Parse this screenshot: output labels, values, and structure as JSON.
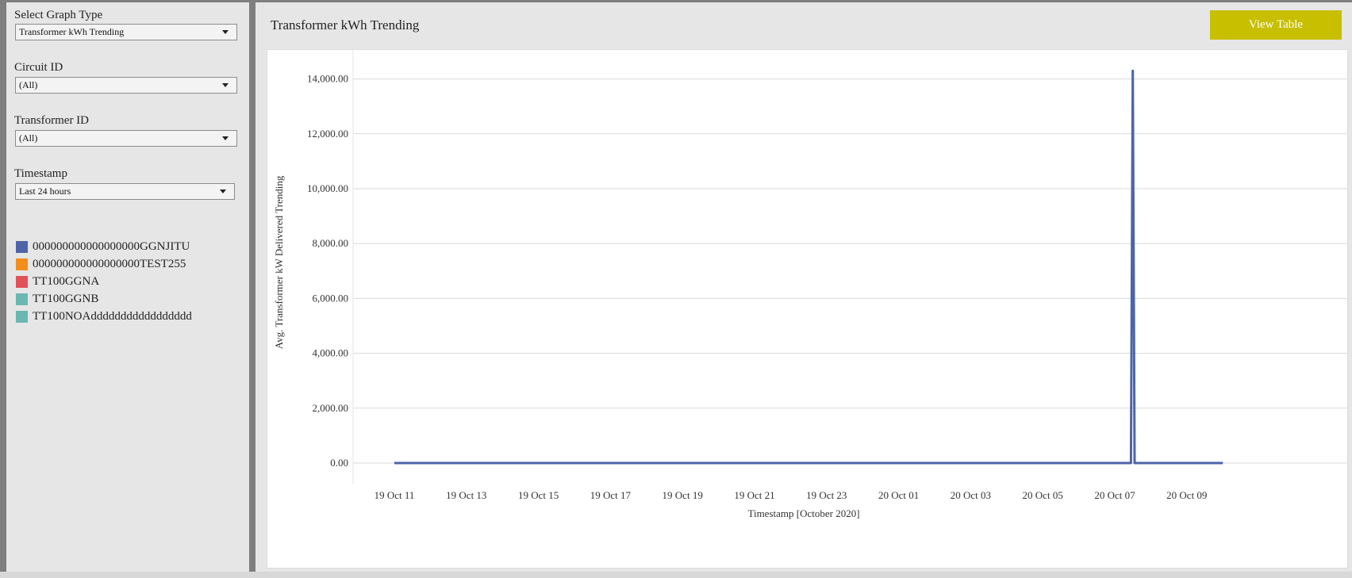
{
  "filters": {
    "graph_type": {
      "label": "Select Graph Type",
      "value": "Transformer kWh Trending"
    },
    "circuit_id": {
      "label": "Circuit ID",
      "value": "(All)"
    },
    "transformer_id": {
      "label": "Transformer ID",
      "value": "(All)"
    },
    "timestamp": {
      "label": "Timestamp",
      "value": "Last 24 hours"
    }
  },
  "legend": [
    {
      "label": "000000000000000000GGNJITU",
      "color": "#4e64a8"
    },
    {
      "label": "000000000000000000TEST255",
      "color": "#f28e1c"
    },
    {
      "label": "TT100GGNA",
      "color": "#e15259"
    },
    {
      "label": "TT100GGNB",
      "color": "#6ab8b0"
    },
    {
      "label": "TT100NOAddddddddddddddddd",
      "color": "#6ab8b0"
    }
  ],
  "header": {
    "title": "Transformer kWh Trending",
    "view_table_label": "View Table"
  },
  "chart_data": {
    "type": "line",
    "xlabel": "Timestamp [October 2020]",
    "ylabel": "Avg. Transformer kW Delivered Trending",
    "ylim": [
      0,
      15000
    ],
    "yticks": [
      "0.00",
      "2,000.00",
      "4,000.00",
      "6,000.00",
      "8,000.00",
      "10,000.00",
      "12,000.00",
      "14,000.00"
    ],
    "ytick_values": [
      0,
      2000,
      4000,
      6000,
      8000,
      10000,
      12000,
      14000
    ],
    "xticks": [
      "19 Oct 11",
      "19 Oct 13",
      "19 Oct 15",
      "19 Oct 17",
      "19 Oct 19",
      "19 Oct 21",
      "19 Oct 23",
      "20 Oct 01",
      "20 Oct 03",
      "20 Oct 05",
      "20 Oct 07",
      "20 Oct 09"
    ],
    "xtick_hours": [
      0,
      2,
      4,
      6,
      8,
      10,
      12,
      14,
      16,
      18,
      20,
      22
    ],
    "grid": true,
    "series": [
      {
        "name": "000000000000000000GGNJITU",
        "color": "#4e64a8",
        "x_hours": [
          0,
          4,
          8,
          12,
          16,
          18.5,
          20.45,
          20.5,
          20.55,
          21,
          22,
          23
        ],
        "values": [
          0,
          0,
          0,
          0,
          0,
          0,
          0,
          14300,
          0,
          0,
          0,
          0
        ]
      }
    ]
  }
}
